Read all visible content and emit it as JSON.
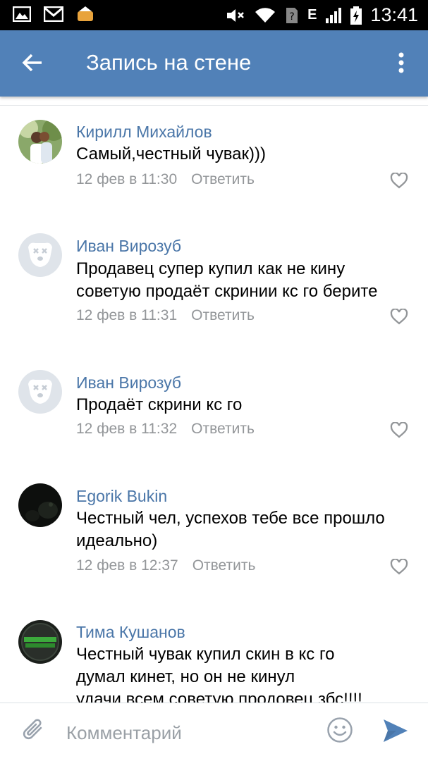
{
  "status_bar": {
    "time": "13:41",
    "network_label": "E",
    "left_icons": [
      "gallery-icon",
      "gmail-icon",
      "app-notification-icon"
    ],
    "right_icons": [
      "mute-icon",
      "wifi-icon",
      "no-sim-icon",
      "signal-icon",
      "battery-icon"
    ]
  },
  "app_bar": {
    "title": "Запись на стене",
    "back_icon": "arrow-left-icon",
    "menu_icon": "more-vertical-icon",
    "color": "#5181b8"
  },
  "comments": [
    {
      "author": "Кирилл Михайлов",
      "text": "Самый,честный чувак)))",
      "date": "12 фев в 11:30",
      "reply_label": "Ответить",
      "avatar": "photo"
    },
    {
      "author": "Иван Вирозуб",
      "text": "Продавец  супер купил как не кину\nсоветую продаёт скринии кс го берите",
      "date": "12 фев в 11:31",
      "reply_label": "Ответить",
      "avatar": "default-dog"
    },
    {
      "author": "Иван Вирозуб",
      "text": "Продаёт скрини кс го",
      "date": "12 фев в 11:32",
      "reply_label": "Ответить",
      "avatar": "default-dog"
    },
    {
      "author": "Egorik Bukin",
      "text": "Честный чел, успехов тебе все прошло\nидеально)",
      "date": "12 фев в 12:37",
      "reply_label": "Ответить",
      "avatar": "dark-photo"
    },
    {
      "author": "Тима Кушанов",
      "text": "Честный чувак купил скин в кс го\nдумал кинет,  но он не кинул\nудачи всем советую продовец збс!!!!",
      "date": "",
      "reply_label": "",
      "avatar": "green-logo"
    }
  ],
  "composer": {
    "placeholder": "Комментарий",
    "attach_icon": "paperclip-icon",
    "emoji_icon": "smiley-icon",
    "send_icon": "send-icon"
  },
  "colors": {
    "link": "#4a76a8",
    "meta": "#939699",
    "accent": "#5181b8"
  }
}
